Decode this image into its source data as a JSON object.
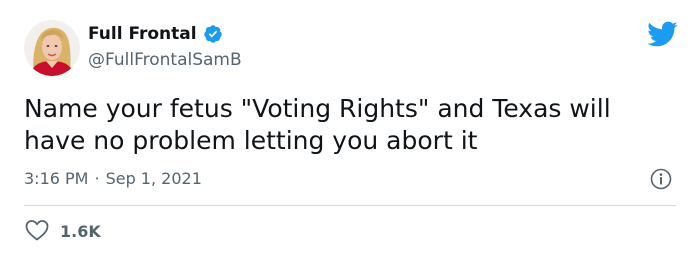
{
  "author": {
    "display_name": "Full Frontal",
    "handle": "@FullFrontalSamB",
    "verified": true
  },
  "tweet": {
    "text": "Name your fetus \"Voting Rights\" and Texas will\nhave no problem letting you abort it",
    "time": "3:16 PM",
    "separator": "·",
    "date": "Sep 1, 2021"
  },
  "engagement": {
    "likes": "1.6K"
  },
  "icons": {
    "brand": "twitter-bird-icon",
    "info": "info-icon",
    "like": "heart-icon",
    "verified": "verified-badge-icon"
  },
  "colors": {
    "twitter_blue": "#1d9bf0",
    "text_primary": "#0f1419",
    "text_secondary": "#536471",
    "divider": "#cfd9de"
  }
}
